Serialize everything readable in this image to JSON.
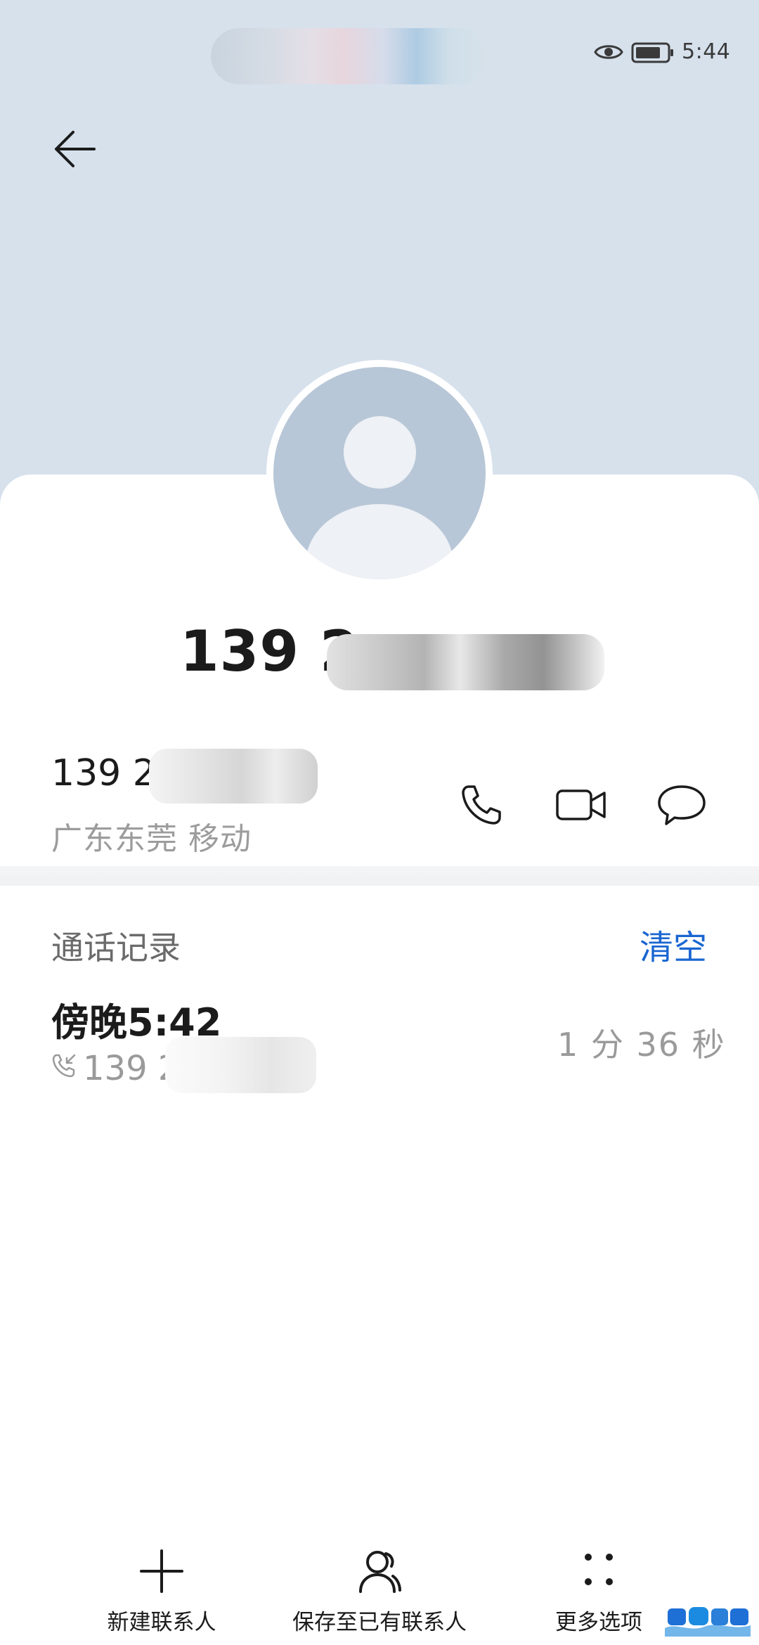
{
  "status_bar": {
    "time": "5:44",
    "icons": [
      "eye-icon",
      "battery-icon"
    ]
  },
  "header": {
    "back_icon": "arrow-left-icon",
    "title": "139 2"
  },
  "contact": {
    "number_prefix": "139 2",
    "location": "广东东莞 移动",
    "actions": [
      {
        "name": "call",
        "icon": "phone-icon"
      },
      {
        "name": "video",
        "icon": "video-camera-icon"
      },
      {
        "name": "message",
        "icon": "message-bubble-icon"
      }
    ]
  },
  "call_log": {
    "title": "通话记录",
    "clear_label": "清空",
    "entries": [
      {
        "time": "傍晚5:42",
        "number_prefix": "139 2",
        "type_icon": "incoming-call-icon",
        "duration": "1 分 36 秒"
      }
    ]
  },
  "bottom_bar": {
    "items": [
      {
        "label": "新建联系人",
        "icon": "plus-icon"
      },
      {
        "label": "保存至已有联系人",
        "icon": "person-icon"
      },
      {
        "label": "更多选项",
        "icon": "four-dots-icon"
      }
    ]
  },
  "colors": {
    "header_bg": "#d6e1ec",
    "avatar_bg": "#b8c7d7",
    "accent": "#1a66d2",
    "secondary_text": "#9c9c9c"
  }
}
